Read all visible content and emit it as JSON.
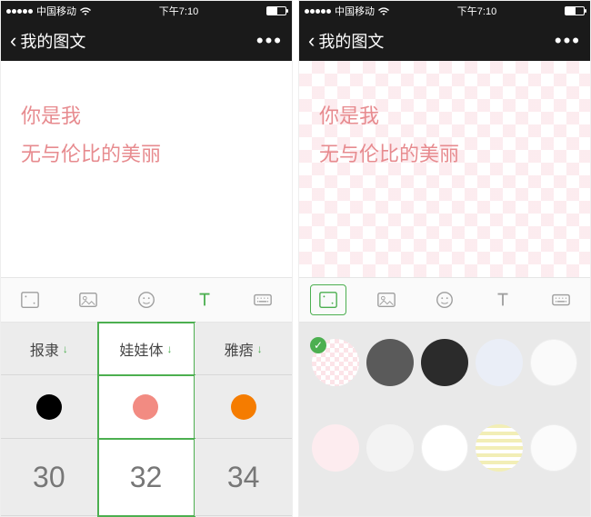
{
  "status": {
    "carrier": "中国移动",
    "time": "下午7:10"
  },
  "nav": {
    "title": "我的图文",
    "more": "•••"
  },
  "text": {
    "line1": "你是我",
    "line2": "无与伦比的美丽"
  },
  "toolbar": {
    "icons": [
      "bg-pattern-icon",
      "photo-icon",
      "emoji-icon",
      "text-icon",
      "keyboard-icon"
    ]
  },
  "font_panel": {
    "fonts": [
      {
        "name": "报隶",
        "downloadable": true
      },
      {
        "name": "娃娃体",
        "downloadable": true,
        "selected": true
      },
      {
        "name": "雅痞",
        "downloadable": true
      }
    ],
    "colors": [
      "#000000",
      "#f28b82",
      "#f57c00"
    ],
    "sizes": [
      30,
      32,
      34
    ],
    "selected_col": 1
  },
  "bg_panel": {
    "swatches": [
      {
        "type": "checker",
        "selected": true
      },
      {
        "type": "solid",
        "color": "#5a5a5a"
      },
      {
        "type": "solid",
        "color": "#2b2b2b"
      },
      {
        "type": "solid",
        "color": "#eaeef7"
      },
      {
        "type": "solid",
        "color": "#fafafa"
      },
      {
        "type": "solid",
        "color": "#fdecef"
      },
      {
        "type": "solid",
        "color": "#f3f3f3"
      },
      {
        "type": "solid",
        "color": "#ffffff"
      },
      {
        "type": "grid",
        "color": "#f2eeb6"
      },
      {
        "type": "solid",
        "color": "#fbfbfb"
      }
    ]
  }
}
